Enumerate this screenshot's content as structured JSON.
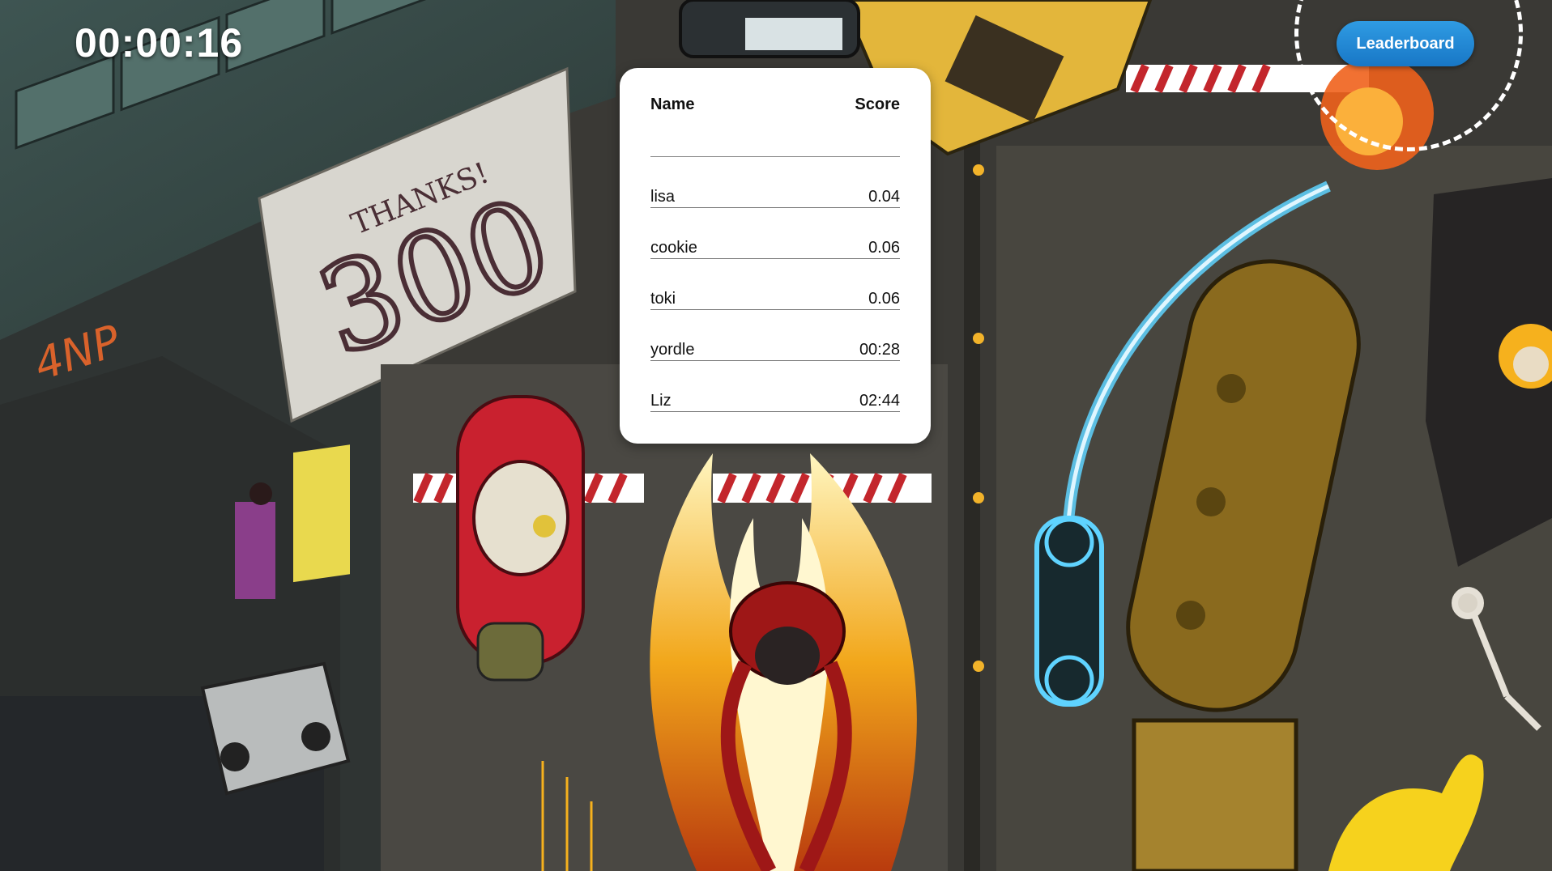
{
  "hud": {
    "timer": "00:00:16",
    "leaderboard_button": "Leaderboard"
  },
  "leaderboard": {
    "headers": {
      "name": "Name",
      "score": "Score"
    },
    "rows": [
      {
        "name": "lisa",
        "score": "0.04"
      },
      {
        "name": "cookie",
        "score": "0.06"
      },
      {
        "name": "toki",
        "score": "0.06"
      },
      {
        "name": "yordle",
        "score": "00:28"
      },
      {
        "name": "Liz",
        "score": "02:44"
      }
    ]
  },
  "scene": {
    "banner_text_top": "THANKS!",
    "banner_text_big": "300"
  },
  "colors": {
    "button": "#1f86d4",
    "timer": "#ffffff",
    "car": "#c9212f",
    "tanker": "#8a6a1e",
    "fire": "#f2a71b",
    "neon": "#5fd3ff"
  }
}
